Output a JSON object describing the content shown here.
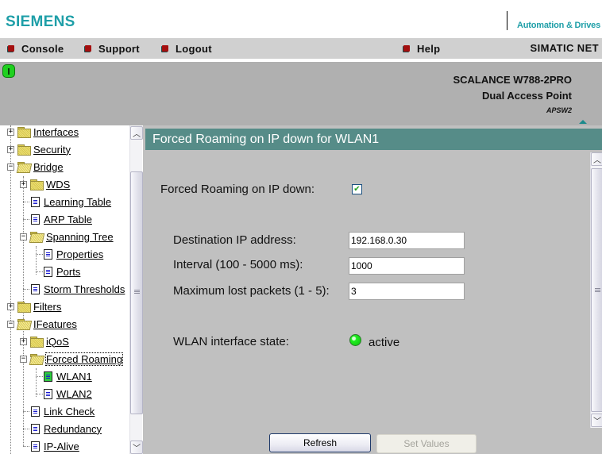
{
  "brand": {
    "logo": "SIEMENS",
    "tagline": "Automation & Drives"
  },
  "menu": {
    "items": [
      {
        "label": "Console",
        "icon": "red-square-bullet"
      },
      {
        "label": "Support",
        "icon": "red-square-bullet"
      },
      {
        "label": "Logout",
        "icon": "red-square-bullet"
      },
      {
        "label": "Help",
        "icon": "red-square-bullet"
      }
    ],
    "product_line": "SIMATIC NET"
  },
  "header": {
    "status_icon": "green-status-led",
    "device_model": "SCALANCE W788-2PRO",
    "device_type": "Dual Access Point",
    "device_name": "APSW2",
    "collapse_icon": "triangle-up-icon"
  },
  "tree": {
    "items": [
      {
        "label": "Interfaces",
        "type": "folder",
        "state": "collapsed",
        "level": 0
      },
      {
        "label": "Security",
        "type": "folder",
        "state": "collapsed",
        "level": 0
      },
      {
        "label": "Bridge",
        "type": "folder",
        "state": "expanded",
        "level": 0
      },
      {
        "label": "WDS",
        "type": "folder",
        "state": "collapsed",
        "level": 1
      },
      {
        "label": "Learning Table",
        "type": "page",
        "level": 1
      },
      {
        "label": "ARP Table",
        "type": "page",
        "level": 1
      },
      {
        "label": "Spanning Tree",
        "type": "folder",
        "state": "expanded",
        "level": 1
      },
      {
        "label": "Properties",
        "type": "page",
        "level": 2
      },
      {
        "label": "Ports",
        "type": "page",
        "level": 2
      },
      {
        "label": "Storm Thresholds",
        "type": "page",
        "level": 1
      },
      {
        "label": "Filters",
        "type": "folder",
        "state": "collapsed",
        "level": 0
      },
      {
        "label": "IFeatures",
        "type": "folder",
        "state": "expanded",
        "level": 0
      },
      {
        "label": "iQoS",
        "type": "folder",
        "state": "collapsed",
        "level": 1
      },
      {
        "label": "Forced Roaming",
        "type": "folder",
        "state": "expanded",
        "level": 1,
        "focused": true
      },
      {
        "label": "WLAN1",
        "type": "page",
        "level": 2,
        "selected": true
      },
      {
        "label": "WLAN2",
        "type": "page",
        "level": 2
      },
      {
        "label": "Link Check",
        "type": "page",
        "level": 1
      },
      {
        "label": "Redundancy",
        "type": "page",
        "level": 1
      },
      {
        "label": "IP-Alive",
        "type": "page",
        "level": 1
      }
    ]
  },
  "content": {
    "title": "Forced Roaming on IP down for WLAN1",
    "forced_roaming": {
      "label": "Forced Roaming on IP down:",
      "checked": true
    },
    "fields": [
      {
        "label": "Destination IP address:",
        "value": "192.168.0.30"
      },
      {
        "label": "Interval (100 - 5000 ms):",
        "value": "1000"
      },
      {
        "label": "Maximum lost packets (1 - 5):",
        "value": "3"
      }
    ],
    "wlan_state": {
      "label": "WLAN interface state:",
      "value": "active",
      "color": "#20f020"
    },
    "buttons": {
      "refresh": "Refresh",
      "set_values": "Set Values"
    }
  },
  "colors": {
    "brand": "#1f9fa8",
    "title_bar": "#568c88",
    "menu_bullet": "#a40f0f"
  }
}
